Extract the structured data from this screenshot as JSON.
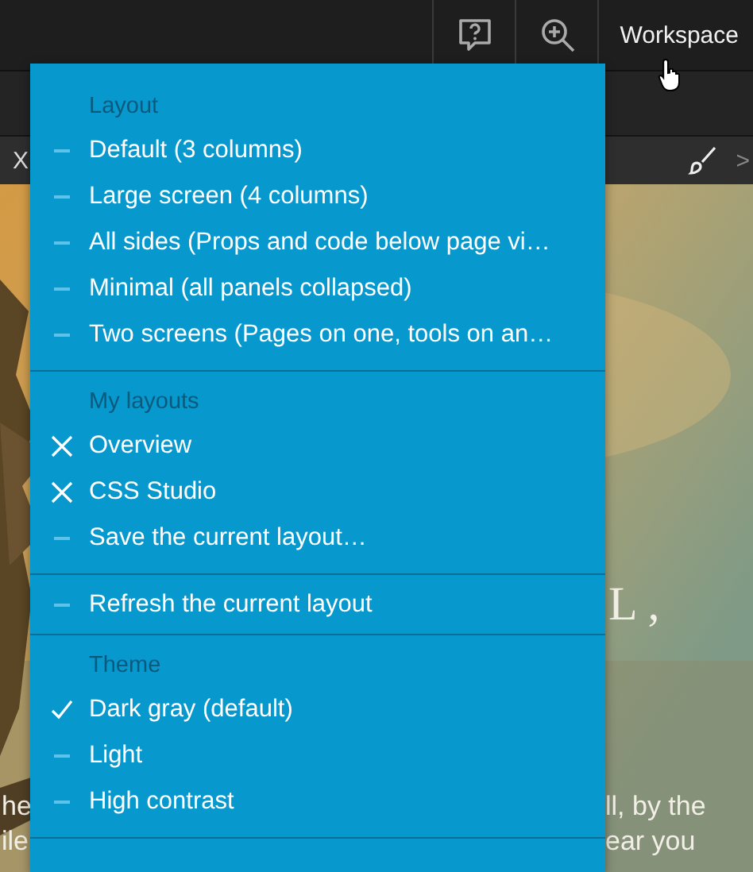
{
  "toolbar": {
    "workspace_label": "Workspace"
  },
  "tab_bar": {
    "close_label": "X",
    "next_label": ">"
  },
  "page_text": [
    {
      "text": "L ,",
      "kind": "heading"
    },
    {
      "text": "he",
      "kind": "left"
    },
    {
      "text": "ll, by the",
      "kind": "right"
    },
    {
      "text": "ile",
      "kind": "left"
    },
    {
      "text": "ear you",
      "kind": "right"
    }
  ],
  "menu": {
    "sections": [
      {
        "heading": "Layout",
        "items": [
          {
            "label": "Default (3 columns)",
            "kind": "action",
            "selected": false
          },
          {
            "label": "Large screen (4 columns)",
            "kind": "action",
            "selected": false
          },
          {
            "label": "All sides (Props and code below page vi…",
            "kind": "action",
            "selected": false
          },
          {
            "label": "Minimal (all panels collapsed)",
            "kind": "action",
            "selected": false
          },
          {
            "label": "Two screens (Pages on one, tools on an…",
            "kind": "action",
            "selected": false
          }
        ]
      },
      {
        "heading": "My layouts",
        "items": [
          {
            "label": "Overview",
            "kind": "removable",
            "selected": false
          },
          {
            "label": "CSS Studio",
            "kind": "removable",
            "selected": false
          },
          {
            "label": "Save the current layout…",
            "kind": "action",
            "selected": false
          }
        ]
      },
      {
        "items": [
          {
            "label": "Refresh the current layout",
            "kind": "action",
            "selected": false
          }
        ]
      },
      {
        "heading": "Theme",
        "items": [
          {
            "label": "Dark gray (default)",
            "kind": "action",
            "selected": true
          },
          {
            "label": "Light",
            "kind": "action",
            "selected": false
          },
          {
            "label": "High contrast",
            "kind": "action",
            "selected": false
          }
        ]
      }
    ]
  }
}
